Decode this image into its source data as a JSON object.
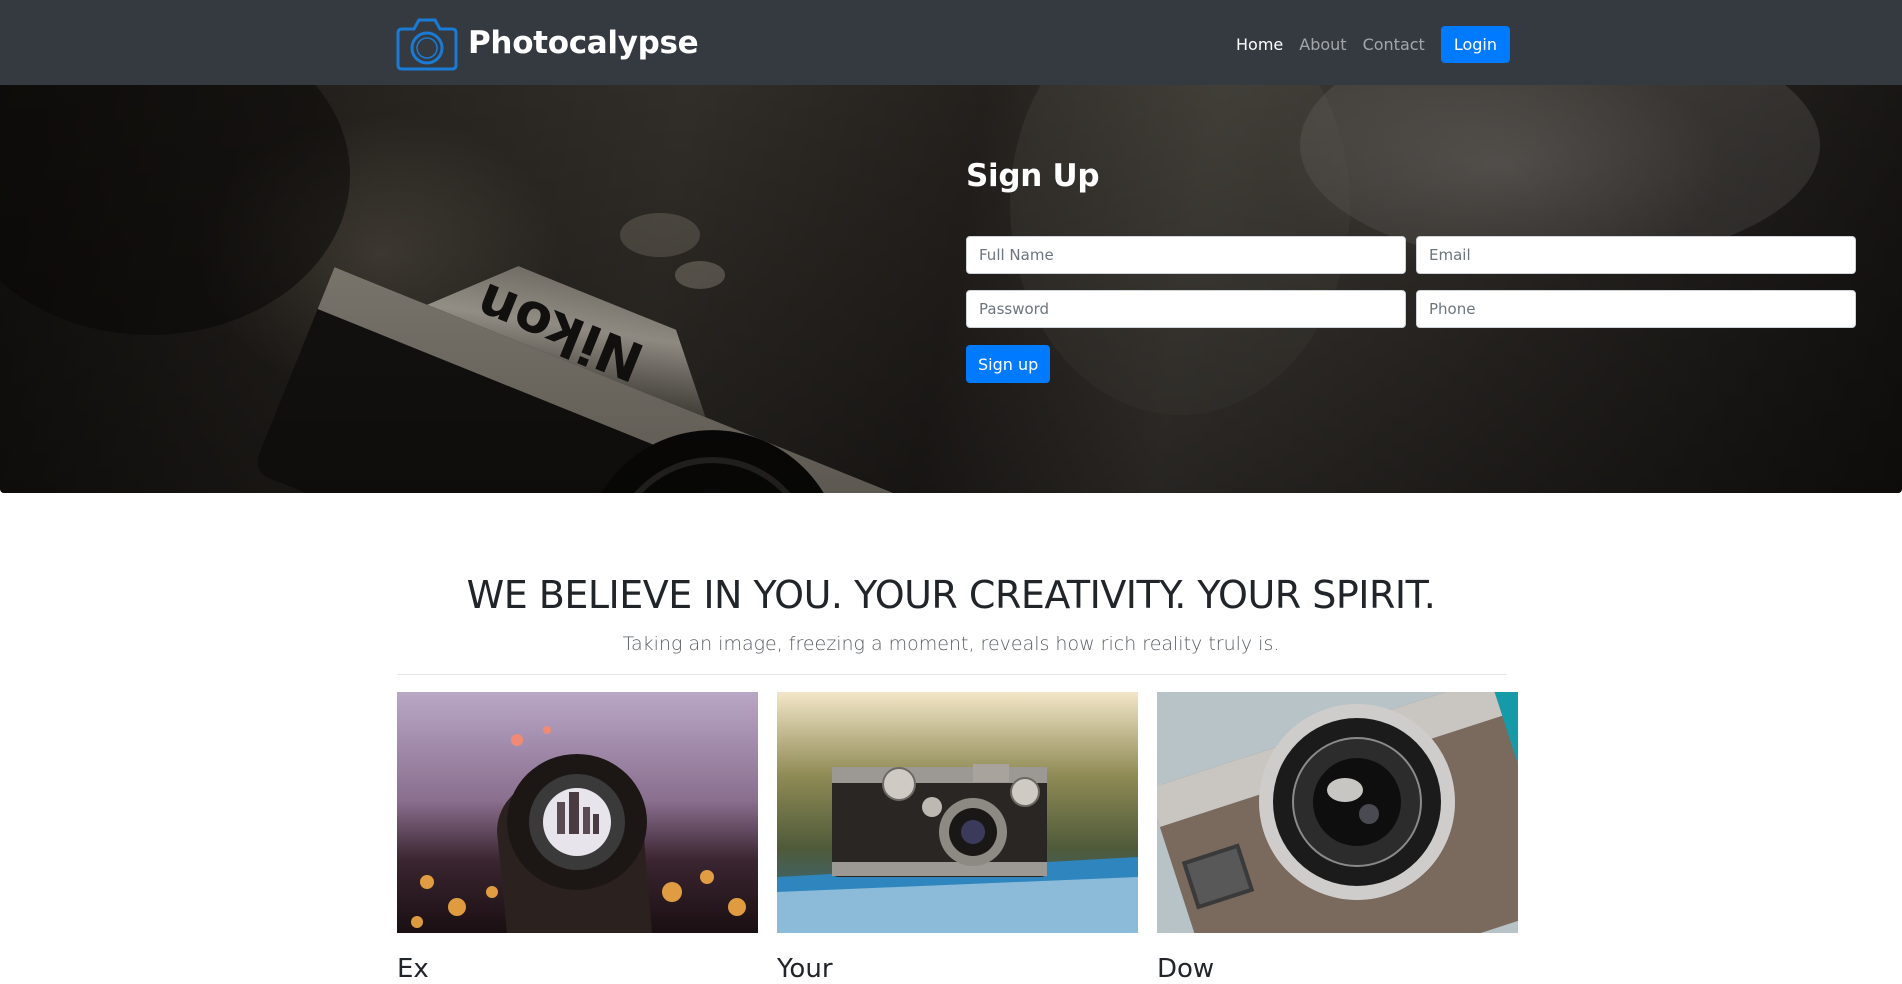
{
  "navbar": {
    "brand_name": "Photocalypse",
    "brand_icon": "camera-icon",
    "links": [
      {
        "label": "Home",
        "active": true
      },
      {
        "label": "About",
        "active": false
      },
      {
        "label": "Contact",
        "active": false
      }
    ],
    "login_label": "Login"
  },
  "signup": {
    "title": "Sign Up",
    "full_name_placeholder": "Full Name",
    "email_placeholder": "Email",
    "password_placeholder": "Password",
    "phone_placeholder": "Phone",
    "submit_label": "Sign up"
  },
  "tagline": {
    "heading": "WE BELIEVE IN YOU. YOUR CREATIVITY. YOUR SPIRIT.",
    "lead": "Taking an image, freezing a moment, reveals how rich reality truly is."
  },
  "cards": [
    {
      "title": "Ex"
    },
    {
      "title": "Your"
    },
    {
      "title": "Dow"
    }
  ],
  "colors": {
    "navbar_bg": "#343a40",
    "accent": "#007bff",
    "hero_dark": "#1c1a17"
  }
}
